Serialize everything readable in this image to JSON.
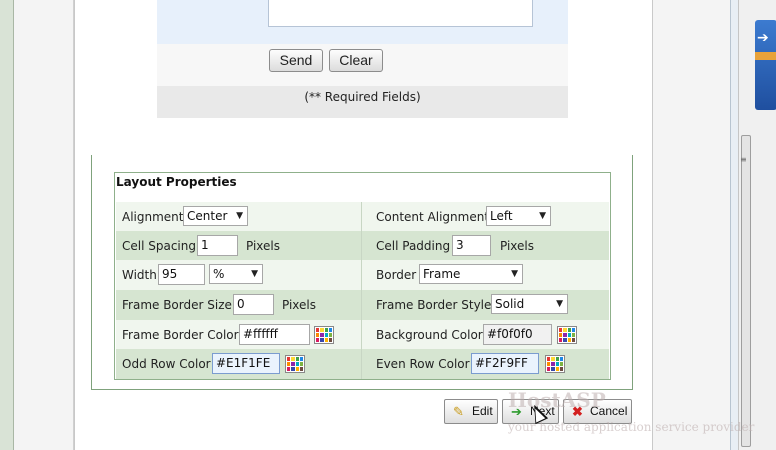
{
  "form": {
    "send_label": "Send",
    "clear_label": "Clear",
    "required_note": "(** Required Fields)"
  },
  "layout_properties": {
    "title": "Layout Properties",
    "alignment": {
      "label": "Alignment",
      "value": "Center"
    },
    "content_alignment": {
      "label": "Content Alignment",
      "value": "Left"
    },
    "cell_spacing": {
      "label": "Cell Spacing",
      "value": "1",
      "unit": "Pixels"
    },
    "cell_padding": {
      "label": "Cell Padding",
      "value": "3",
      "unit": "Pixels"
    },
    "width": {
      "label": "Width",
      "value": "95",
      "unit_value": "%"
    },
    "border": {
      "label": "Border",
      "value": "Frame"
    },
    "frame_border_size": {
      "label": "Frame Border Size",
      "value": "0",
      "unit": "Pixels"
    },
    "frame_border_style": {
      "label": "Frame Border Style",
      "value": "Solid"
    },
    "frame_border_color": {
      "label": "Frame Border Color",
      "value": "#ffffff"
    },
    "background_color": {
      "label": "Background Color",
      "value": "#f0f0f0"
    },
    "odd_row_color": {
      "label": "Odd Row Color",
      "value": "#E1F1FE"
    },
    "even_row_color": {
      "label": "Even Row Color",
      "value": "#F2F9FF"
    }
  },
  "actions": {
    "edit_label": "Edit",
    "next_label": "Next",
    "cancel_label": "Cancel"
  },
  "watermark": {
    "brand": "HostASP",
    "tagline": "your hosted application service provider"
  },
  "colors": {
    "row_odd": "#f0f6ee",
    "row_even": "#d6e5d1",
    "panel_border": "#8fb08b",
    "form_bg": "#e7f0fb"
  },
  "icons": {
    "edit": "pencil-icon",
    "next": "green-arrow-right-icon",
    "cancel": "red-x-icon",
    "picker": "color-palette-icon"
  }
}
